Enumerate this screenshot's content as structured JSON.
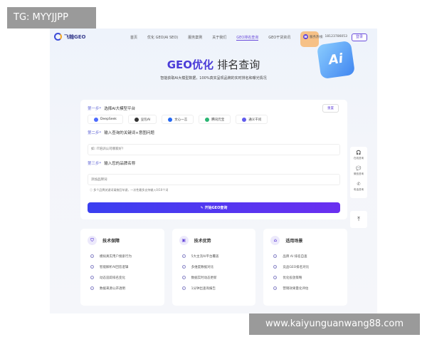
{
  "overlay": {
    "tg": "TG: MYYJJPP",
    "site": "www.kaiyunguanwang88.com"
  },
  "nav": {
    "logo": "飞翰GEO",
    "links": [
      "首页",
      "优化 GEO(AI SEO)",
      "服务案例",
      "关于我们",
      "GEO排名查询",
      "GEO干货资讯"
    ],
    "active": 4,
    "phone_label": "服务热线:",
    "phone": "18123786053",
    "login": "登录"
  },
  "hero": {
    "title_accent": "GEO优化",
    "title_rest": "排名查询",
    "subtitle": "智能获取AI大模型数据，100%真实呈现品牌的实时排名和曝光情况",
    "deco": "Ai"
  },
  "form": {
    "step1": {
      "tag": "第一步*",
      "label": "选择AI大模型平台",
      "reset": "重置"
    },
    "platforms": [
      "DeepSeek",
      "豆包AI",
      "文心一言",
      "腾讯元宝",
      "通义千问"
    ],
    "platform_colors": [
      "#4d6bfe",
      "#333333",
      "#2468f2",
      "#2bb673",
      "#615ced"
    ],
    "step2": {
      "tag": "第二步*",
      "label": "输入查询的关键词+意图问题",
      "placeholder": "如: IT培训公司哪家好?"
    },
    "step3": {
      "tag": "第三步*",
      "label": "输入您的品牌名称",
      "placeholder": "添加品牌词"
    },
    "hint": "多个品牌关键词请按回车键，一次性最多支持输入0/10个词",
    "submit": "开始GEO查询"
  },
  "cards": [
    {
      "icon": "shield-icon",
      "title": "技术保障",
      "items": [
        "模拟真实用户搜索行为",
        "智能解析AI回答逻辑",
        "动态追踪排名变化",
        "数据来源公开透明"
      ]
    },
    {
      "icon": "folder-icon",
      "title": "技术优势",
      "items": [
        "5大主流AI平台覆盖",
        "多维度数据对比",
        "数据实时动态更新",
        "1分钟出查询报告"
      ]
    },
    {
      "icon": "building-icon",
      "title": "适用场景",
      "items": [
        "品牌 AI 排名自查",
        "竞品GEO排名对比",
        "优化投放策略",
        "营销效果量化评估"
      ]
    }
  ],
  "float": [
    "在线咨询",
    "微信咨询",
    "电话咨询"
  ]
}
